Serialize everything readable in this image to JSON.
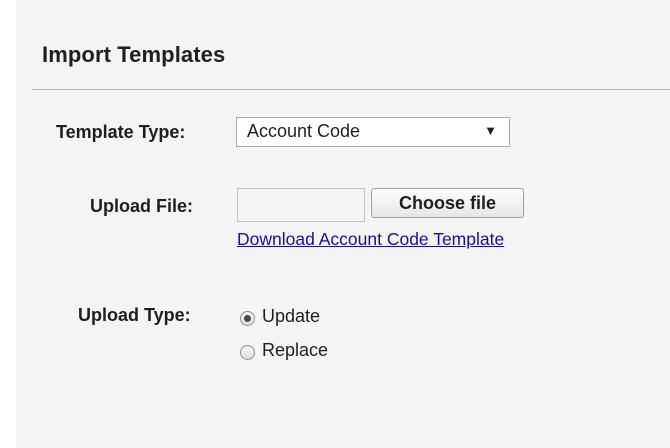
{
  "panel": {
    "title": "Import Templates"
  },
  "form": {
    "template_type": {
      "label": "Template Type:",
      "selected": "Account Code",
      "arrow_icon": "triangle-down"
    },
    "upload_file": {
      "label": "Upload File:",
      "value": "",
      "button_label": "Choose file",
      "download_link": "Download Account Code Template"
    },
    "upload_type": {
      "label": "Upload Type:",
      "options": [
        {
          "label": "Update",
          "checked": true
        },
        {
          "label": "Replace",
          "checked": false
        }
      ]
    }
  },
  "colors": {
    "panel_background": "#f4f4f4",
    "link": "#1a0dab",
    "divider": "#b8b8b8"
  }
}
